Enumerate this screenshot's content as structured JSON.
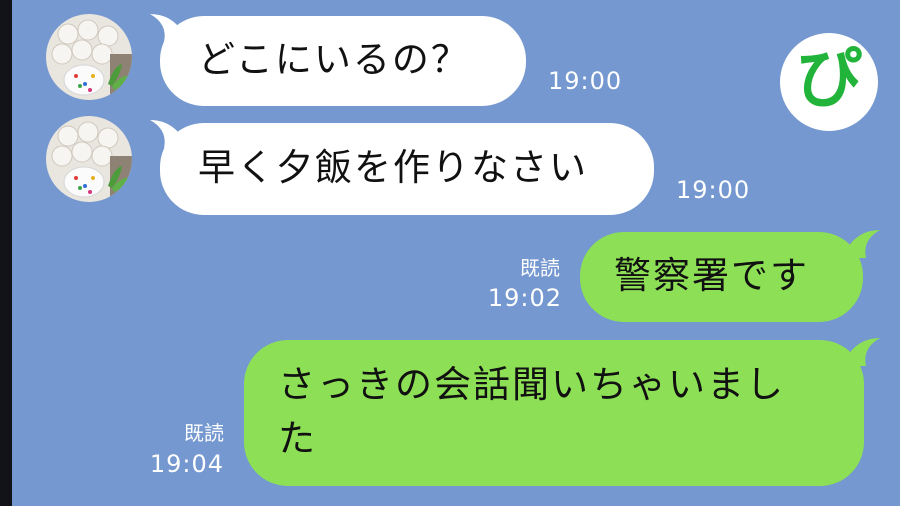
{
  "chat": {
    "messages": [
      {
        "direction": "incoming",
        "text": "どこにいるの？",
        "time": "19:00"
      },
      {
        "direction": "incoming",
        "text": "早く夕飯を作りなさい",
        "time": "19:00"
      },
      {
        "direction": "outgoing",
        "read": "既読",
        "text": "警察署です",
        "time": "19:02"
      },
      {
        "direction": "outgoing",
        "read": "既読",
        "text_line1": "さっきの会話聞いちゃいまし",
        "text_line2": "た",
        "time": "19:04"
      }
    ]
  },
  "logo": {
    "glyph": "ぴ"
  },
  "colors": {
    "background": "#7498cf",
    "incoming_bubble": "#ffffff",
    "outgoing_bubble": "#8de055",
    "logo_green": "#22b43a"
  },
  "icons": [
    "contact-avatar-icon",
    "pia-logo-icon"
  ]
}
